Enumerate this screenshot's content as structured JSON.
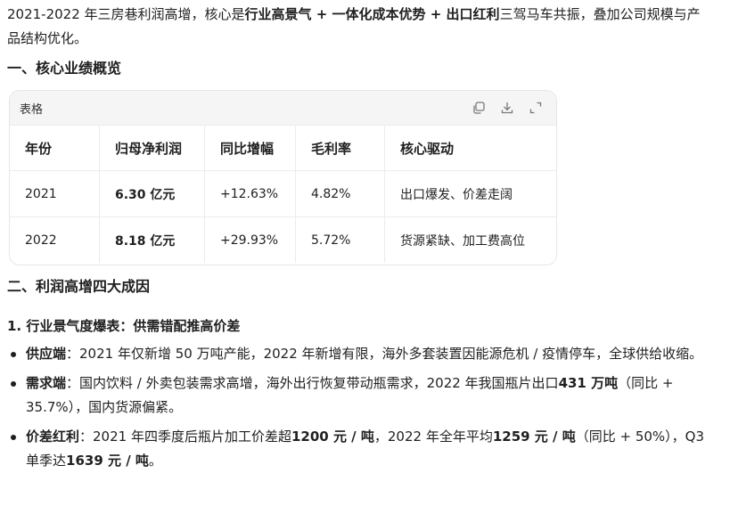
{
  "intro": {
    "p1": "2021-2022 年三房巷利润高增，核心是",
    "b1": "行业高景气 + 一体化成本优势 + 出口红利",
    "p2": "三驾马车共振，叠加公司规模与产品结构优化。"
  },
  "section1_title": "一、核心业绩概览",
  "table": {
    "label": "表格",
    "headers": [
      "年份",
      "归母净利润",
      "同比增幅",
      "毛利率",
      "核心驱动"
    ],
    "rows": [
      [
        "2021",
        "6.30 亿元",
        "+12.63%",
        "4.82%",
        "出口爆发、价差走阔"
      ],
      [
        "2022",
        "8.18 亿元",
        "+29.93%",
        "5.72%",
        "货源紧缺、加工费高位"
      ]
    ]
  },
  "section2_title": "二、利润高增四大成因",
  "subsection1_title": "1. 行业景气度爆表：供需错配推高价差",
  "bullets": [
    {
      "label": "供应端",
      "p1": "：2021 年仅新增 50 万吨产能，2022 年新增有限，海外多套装置因能源危机 / 疫情停车，全球供给收缩。"
    },
    {
      "label": "需求端",
      "p1": "：国内饮料 / 外卖包装需求高增，海外出行恢复带动瓶需求，2022 年我国瓶片出口",
      "b1": "431 万吨",
      "p2": "（同比 + 35.7%），国内货源偏紧。"
    },
    {
      "label": "价差红利",
      "p1": "：2021 年四季度后瓶片加工价差超",
      "b1": "1200 元 / 吨",
      "p2": "，2022 年全年平均",
      "b2": "1259 元 / 吨",
      "p3": "（同比 + 50%），Q3 单季达",
      "b3": "1639 元 / 吨",
      "p4": "。"
    }
  ]
}
